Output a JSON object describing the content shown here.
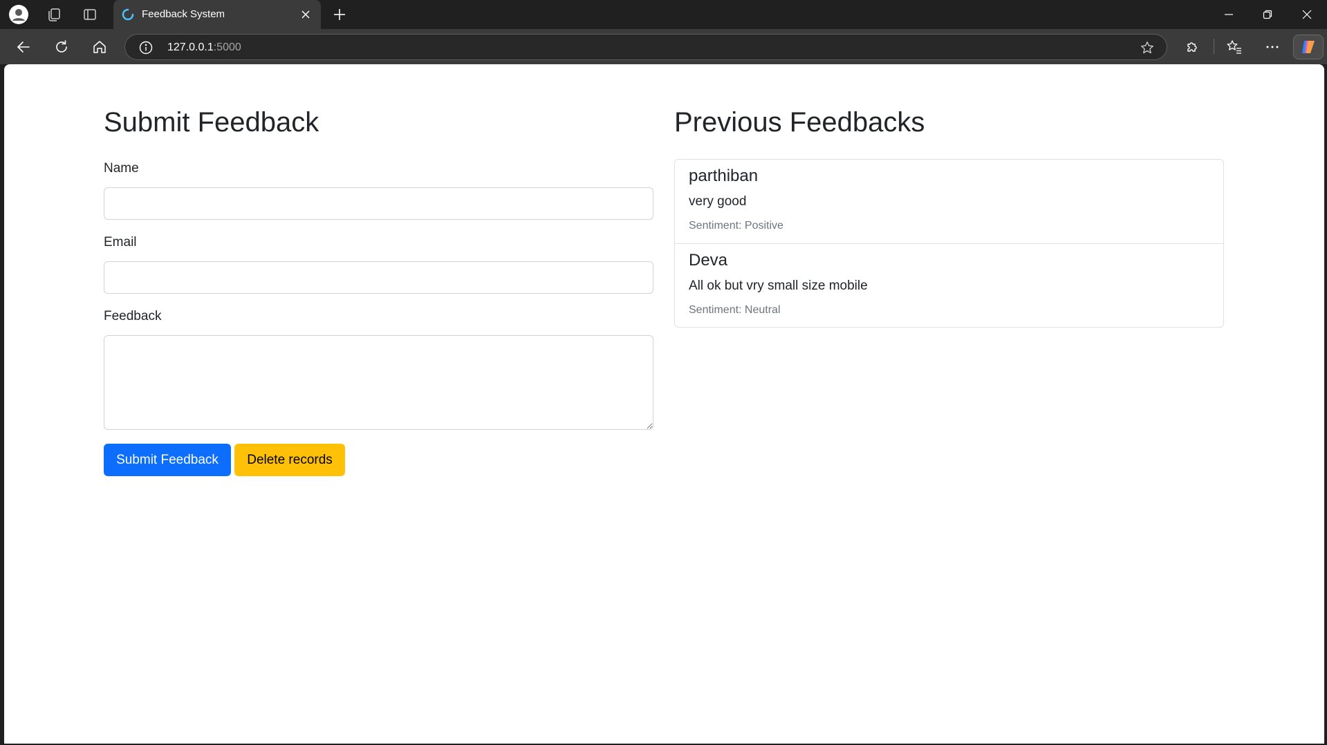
{
  "browser": {
    "tab_title": "Feedback System",
    "url_host": "127.0.0.1",
    "url_port": ":5000"
  },
  "form": {
    "heading": "Submit Feedback",
    "name_label": "Name",
    "name_value": "",
    "email_label": "Email",
    "email_value": "",
    "feedback_label": "Feedback",
    "feedback_value": "",
    "submit_label": "Submit Feedback",
    "delete_label": "Delete records"
  },
  "feedbacks": {
    "heading": "Previous Feedbacks",
    "items": [
      {
        "name": "parthiban",
        "text": "very good",
        "sentiment": "Sentiment: Positive"
      },
      {
        "name": "Deva",
        "text": "All ok but vry small size mobile",
        "sentiment": "Sentiment: Neutral"
      }
    ]
  },
  "colors": {
    "primary": "#0d6efd",
    "warning": "#ffc107",
    "browser_chrome": "#202020",
    "toolbar": "#3b3b3b"
  }
}
